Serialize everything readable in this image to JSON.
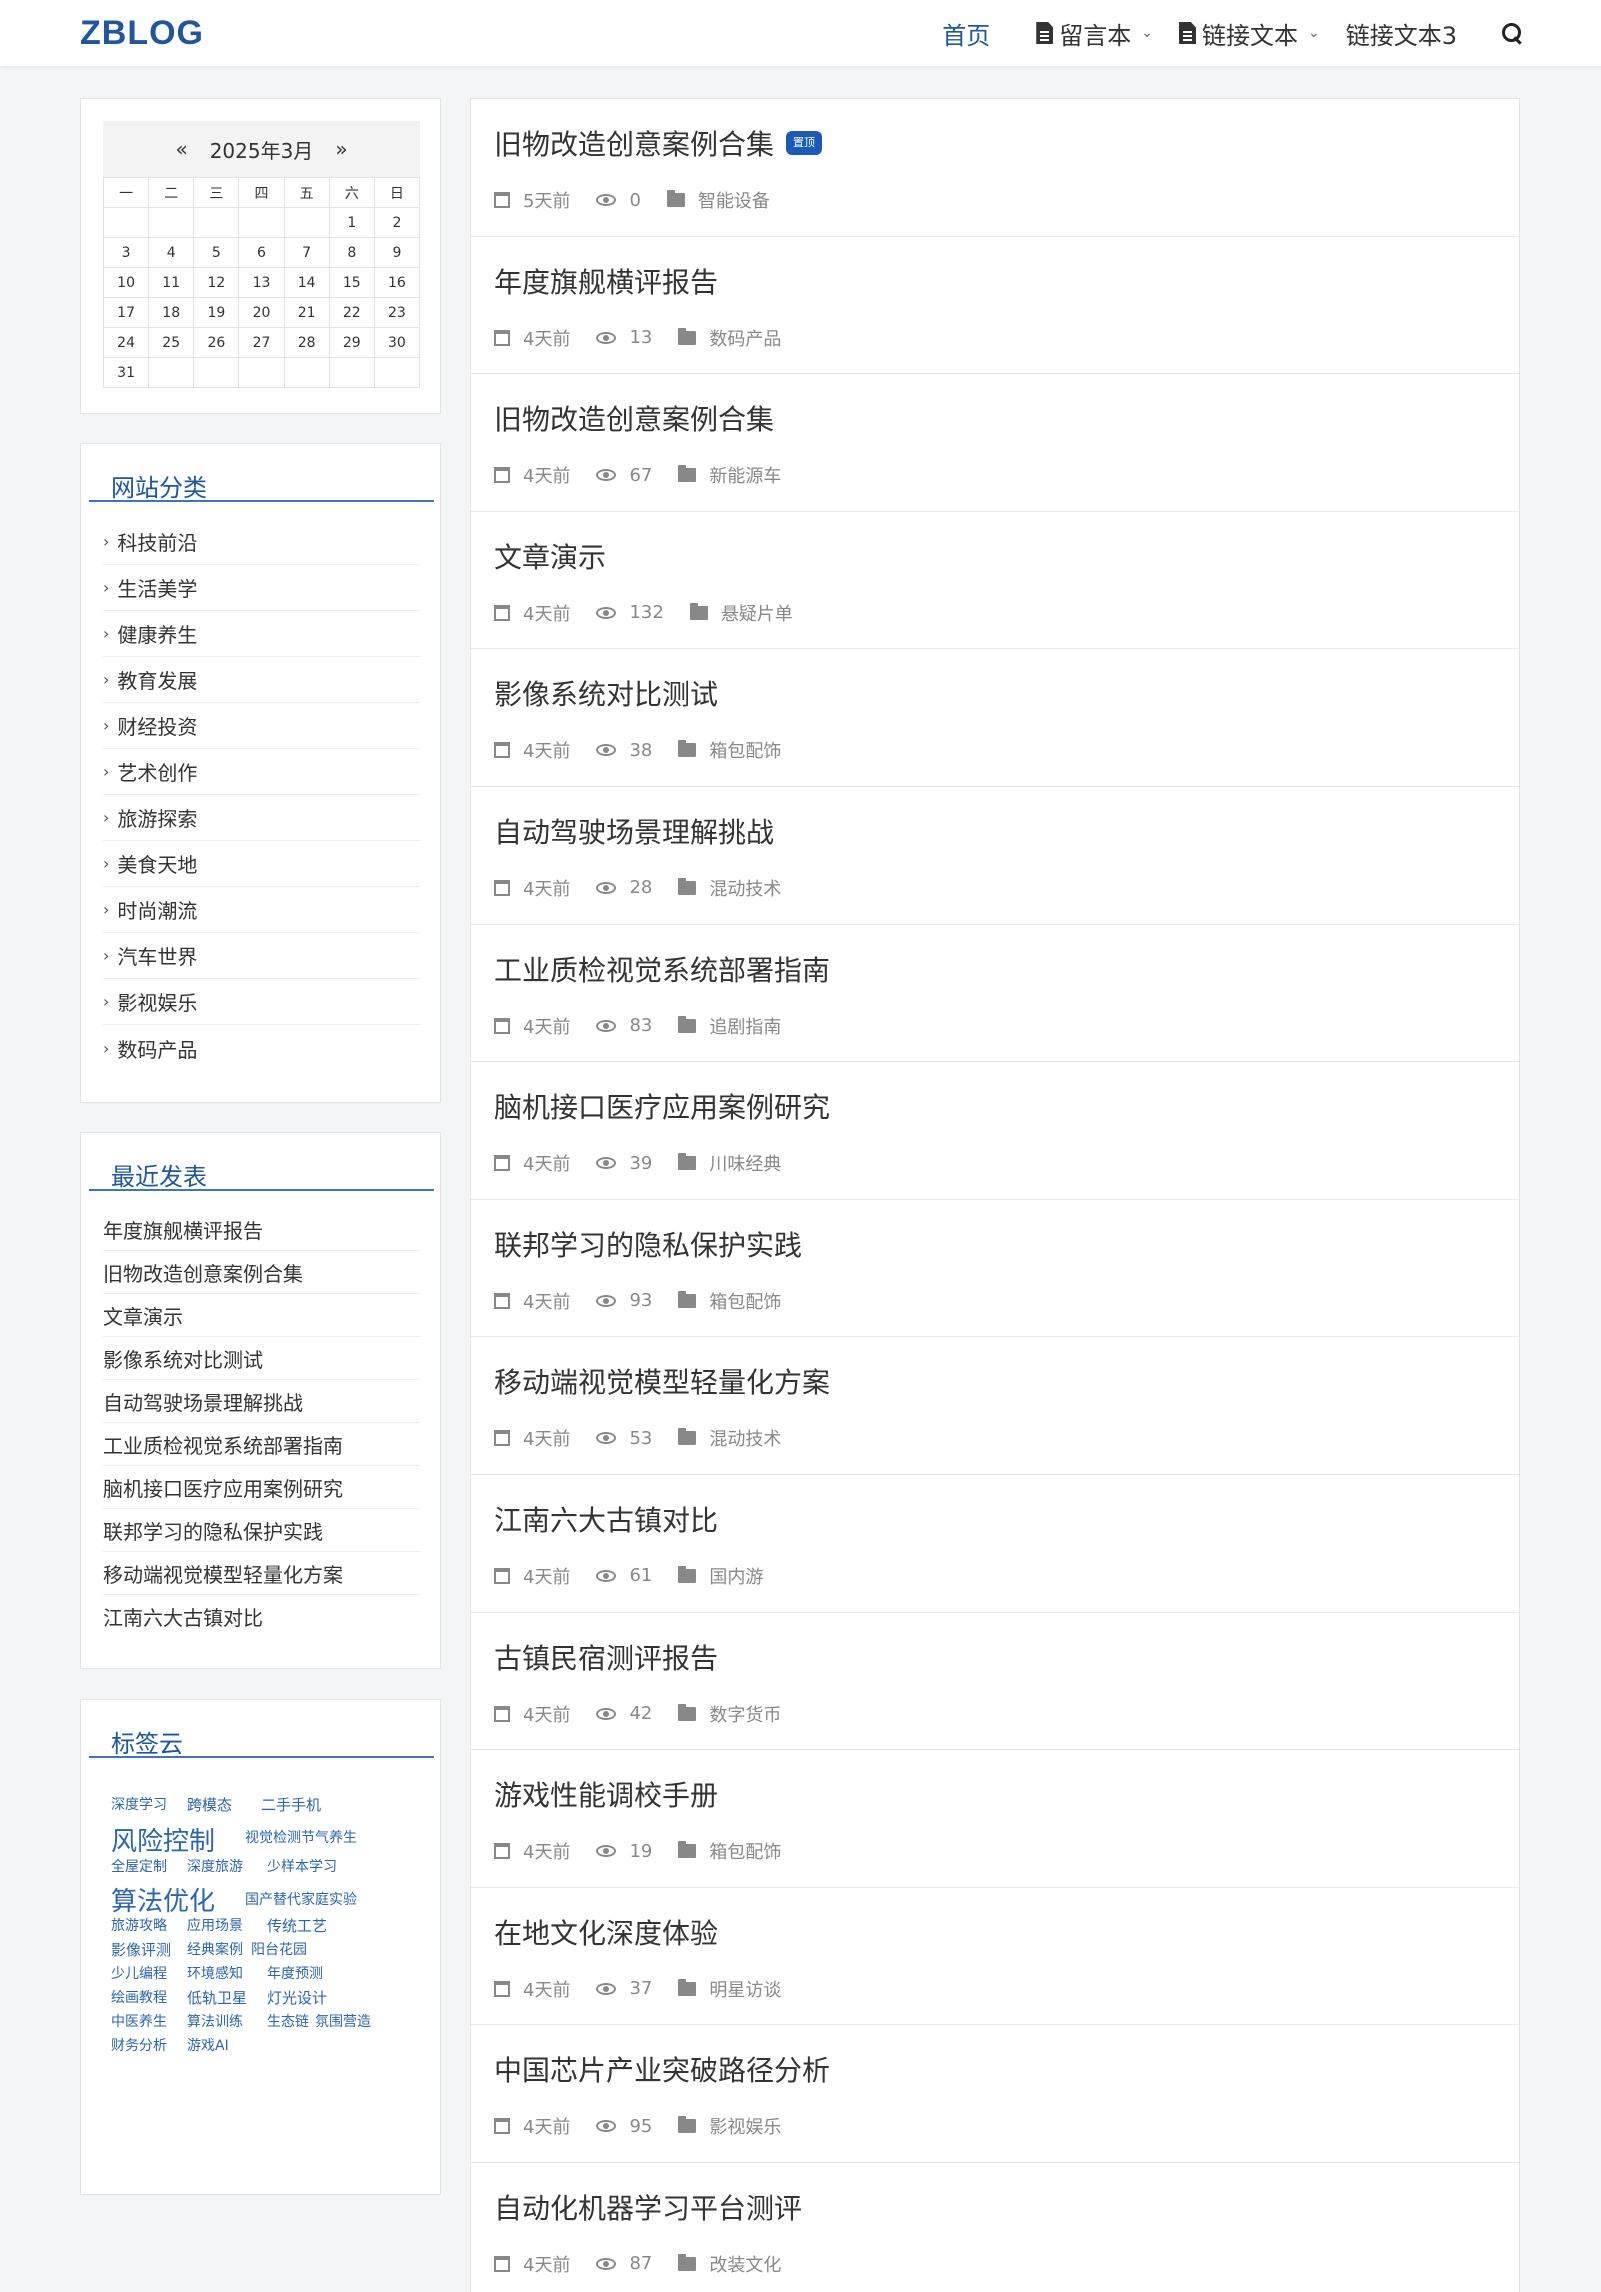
{
  "header": {
    "logo": "ZBLOG",
    "nav": [
      {
        "label": "首页",
        "active": true
      },
      {
        "label": "留言本",
        "icon": "document-icon",
        "has_dropdown": true
      },
      {
        "label": "链接文本",
        "icon": "document-icon",
        "has_dropdown": true
      },
      {
        "label": "链接文本3"
      }
    ]
  },
  "calendar": {
    "prev": "«",
    "title": "2025年3月",
    "next": "»",
    "weekdays": [
      "一",
      "二",
      "三",
      "四",
      "五",
      "六",
      "日"
    ],
    "weeks": [
      [
        "",
        "",
        "",
        "",
        "",
        "1",
        "2"
      ],
      [
        "3",
        "4",
        "5",
        "6",
        "7",
        "8",
        "9"
      ],
      [
        "10",
        "11",
        "12",
        "13",
        "14",
        "15",
        "16"
      ],
      [
        "17",
        "18",
        "19",
        "20",
        "21",
        "22",
        "23"
      ],
      [
        "24",
        "25",
        "26",
        "27",
        "28",
        "29",
        "30"
      ],
      [
        "31",
        "",
        "",
        "",
        "",
        "",
        ""
      ]
    ]
  },
  "categories": {
    "title": "网站分类",
    "items": [
      "科技前沿",
      "生活美学",
      "健康养生",
      "教育发展",
      "财经投资",
      "艺术创作",
      "旅游探索",
      "美食天地",
      "时尚潮流",
      "汽车世界",
      "影视娱乐",
      "数码产品"
    ]
  },
  "recent": {
    "title": "最近发表",
    "items": [
      "年度旗舰横评报告",
      "旧物改造创意案例合集",
      "文章演示",
      "影像系统对比测试",
      "自动驾驶场景理解挑战",
      "工业质检视觉系统部署指南",
      "脑机接口医疗应用案例研究",
      "联邦学习的隐私保护实践",
      "移动端视觉模型轻量化方案",
      "江南六大古镇对比"
    ]
  },
  "tags": {
    "title": "标签云",
    "items": [
      "深度学习",
      "跨模态",
      "二手手机",
      "风险控制",
      "视觉检测",
      "节气养生",
      "全屋定制",
      "深度旅游",
      "少样本学习",
      "算法优化",
      "国产替代",
      "家庭实验",
      "旅游攻略",
      "应用场景",
      "传统工艺",
      "影像评测",
      "经典案例",
      "阳台花园",
      "少儿编程",
      "环境感知",
      "年度预测",
      "绘画教程",
      "低轨卫星",
      "灯光设计",
      "中医养生",
      "算法训练",
      "生态链",
      "氛围营造",
      "财务分析",
      "游戏AI"
    ]
  },
  "posts": [
    {
      "title": "旧物改造创意案例合集",
      "badge": "置顶",
      "time": "5天前",
      "views": "0",
      "category": "智能设备"
    },
    {
      "title": "年度旗舰横评报告",
      "time": "4天前",
      "views": "13",
      "category": "数码产品"
    },
    {
      "title": "旧物改造创意案例合集",
      "time": "4天前",
      "views": "67",
      "category": "新能源车"
    },
    {
      "title": "文章演示",
      "time": "4天前",
      "views": "132",
      "category": "悬疑片单"
    },
    {
      "title": "影像系统对比测试",
      "time": "4天前",
      "views": "38",
      "category": "箱包配饰"
    },
    {
      "title": "自动驾驶场景理解挑战",
      "time": "4天前",
      "views": "28",
      "category": "混动技术"
    },
    {
      "title": "工业质检视觉系统部署指南",
      "time": "4天前",
      "views": "83",
      "category": "追剧指南"
    },
    {
      "title": "脑机接口医疗应用案例研究",
      "time": "4天前",
      "views": "39",
      "category": "川味经典"
    },
    {
      "title": "联邦学习的隐私保护实践",
      "time": "4天前",
      "views": "93",
      "category": "箱包配饰"
    },
    {
      "title": "移动端视觉模型轻量化方案",
      "time": "4天前",
      "views": "53",
      "category": "混动技术"
    },
    {
      "title": "江南六大古镇对比",
      "time": "4天前",
      "views": "61",
      "category": "国内游"
    },
    {
      "title": "古镇民宿测评报告",
      "time": "4天前",
      "views": "42",
      "category": "数字货币"
    },
    {
      "title": "游戏性能调校手册",
      "time": "4天前",
      "views": "19",
      "category": "箱包配饰"
    },
    {
      "title": "在地文化深度体验",
      "time": "4天前",
      "views": "37",
      "category": "明星访谈"
    },
    {
      "title": "中国芯片产业突破路径分析",
      "time": "4天前",
      "views": "95",
      "category": "影视娱乐"
    },
    {
      "title": "自动化机器学习平台测评",
      "time": "4天前",
      "views": "87",
      "category": "改装文化"
    }
  ]
}
